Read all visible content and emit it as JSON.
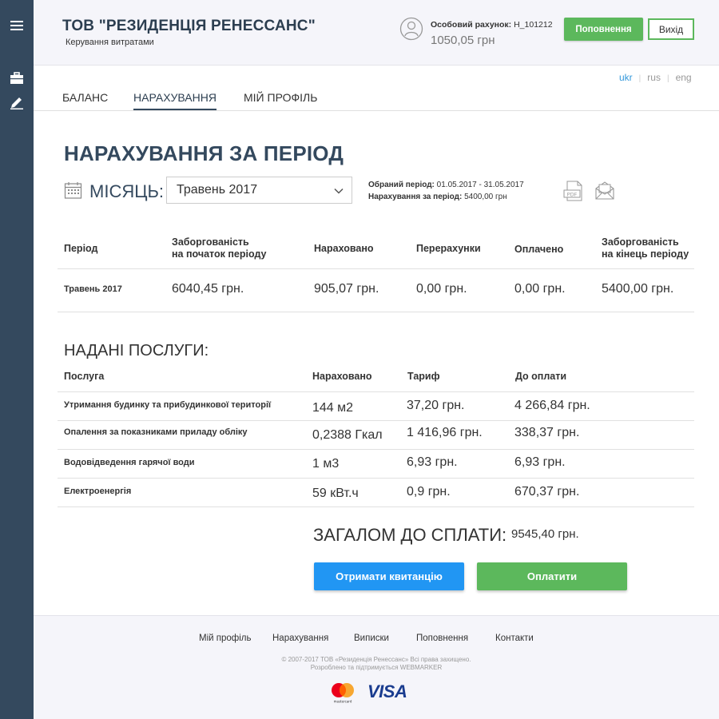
{
  "sidebar": {
    "items": [
      {
        "icon": "menu-icon"
      },
      {
        "icon": "briefcase-icon"
      },
      {
        "icon": "pencil-icon"
      }
    ]
  },
  "header": {
    "company": "ТОВ \"РЕЗИДЕНЦІЯ РЕНЕССАНС\"",
    "subtitle": "Керування витратами",
    "account_label": "Особовий рахунок:",
    "account_number": "Н_101212",
    "balance": "1050,05 грн",
    "topup_label": "Поповнення",
    "exit_label": "Вихід"
  },
  "languages": [
    {
      "code": "ukr",
      "active": true
    },
    {
      "code": "rus",
      "active": false
    },
    {
      "code": "eng",
      "active": false
    }
  ],
  "tabs": [
    {
      "label": "БАЛАНС",
      "active": false
    },
    {
      "label": "НАРАХУВАННЯ",
      "active": true
    },
    {
      "label": "МІЙ ПРОФІЛЬ",
      "active": false
    }
  ],
  "page": {
    "title": "НАРАХУВАННЯ ЗА ПЕРІОД",
    "month_label": "МІСЯЦЬ:",
    "month_selected": "Травень 2017",
    "period_label": "Обраний період:",
    "period_value": "01.05.2017 - 31.05.2017",
    "charge_label": "Нарахування за період:",
    "charge_value": "5400,00 грн"
  },
  "summary_table": {
    "headers": [
      "Період",
      "Заборгованість\nна початок періоду",
      "Нараховано",
      "Перерахунки",
      "Оплачено",
      "Заборгованість\nна кінець періоду"
    ],
    "rows": [
      [
        "Травень 2017",
        "6040,45 грн.",
        "905,07 грн.",
        "0,00 грн.",
        "0,00 грн.",
        "5400,00 грн."
      ]
    ]
  },
  "services": {
    "title": "НАДАНІ ПОСЛУГИ:",
    "headers": [
      "Послуга",
      "Нараховано",
      "Тариф",
      "До оплати"
    ],
    "rows": [
      [
        "Утримання будинку та прибудинкової території",
        "144 м2",
        "37,20 грн.",
        "4 266,84 грн."
      ],
      [
        "Опалення за показниками приладу обліку",
        "0,2388 Гкал",
        "1 416,96 грн.",
        "338,37 грн."
      ],
      [
        "Водовідведення гарячої води",
        "1 м3",
        "6,93 грн.",
        "6,93 грн."
      ],
      [
        "Електроенергія",
        "59 кВт.ч",
        "0,9 грн.",
        "670,37 грн."
      ]
    ]
  },
  "total": {
    "label": "ЗАГАЛОМ ДО СПЛАТИ:",
    "value": "9545,40 грн."
  },
  "actions": {
    "receipt_label": "Отримати квитанцію",
    "pay_label": "Оплатити"
  },
  "footer": {
    "links": [
      "Мій профіль",
      "Нарахування",
      "Виписки",
      "Поповнення",
      "Контакти"
    ],
    "copyright": "© 2007-2017 ТОВ «Резиденція Ренессанс» Всі права захищено.",
    "developer": "Розроблено та підтримується WEBMARKER",
    "mastercard_text": "mastercard",
    "visa_text": "VISA"
  },
  "colors": {
    "sidebar": "#34495e",
    "accent_green": "#5cb85c",
    "accent_blue": "#2196f3",
    "link_active": "#3498db"
  }
}
